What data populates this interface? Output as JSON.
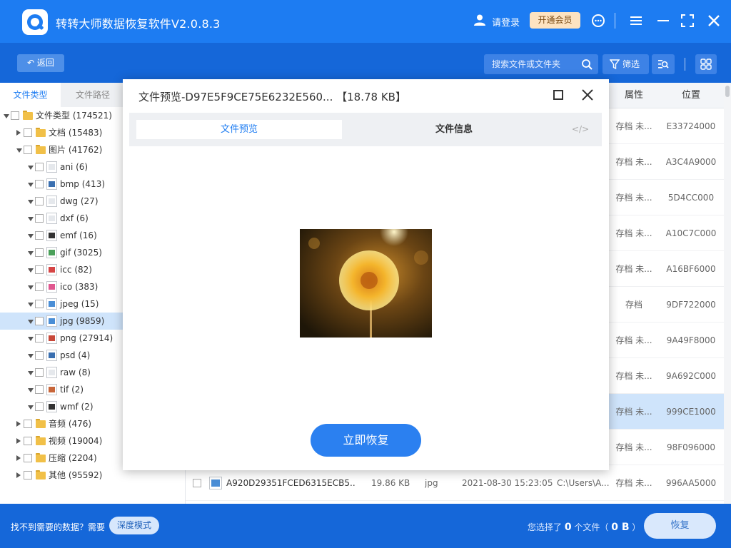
{
  "app": {
    "title": "转转大师数据恢复软件V2.0.8.3",
    "login_label": "请登录",
    "vip_label": "开通会员",
    "brand_color": "#1d7cf2"
  },
  "toolbar": {
    "back_label": "返回",
    "search_placeholder": "搜索文件或文件夹",
    "filter_label": "筛选"
  },
  "sidebar": {
    "tabs": [
      "文件类型",
      "文件路径"
    ],
    "tree": [
      {
        "label": "文件类型",
        "count": "(174521)",
        "type": "folder",
        "expanded": true
      },
      {
        "label": "文档",
        "count": "(15483)",
        "type": "folder",
        "expanded": false
      },
      {
        "label": "图片",
        "count": "(41762)",
        "type": "folder",
        "expanded": true
      },
      {
        "label": "ani",
        "count": "(6)",
        "type": "file",
        "icon": "ani-file-icon"
      },
      {
        "label": "bmp",
        "count": "(413)",
        "type": "file",
        "icon": "bmp-file-icon"
      },
      {
        "label": "dwg",
        "count": "(27)",
        "type": "file",
        "icon": "dwg-file-icon"
      },
      {
        "label": "dxf",
        "count": "(6)",
        "type": "file",
        "icon": "dxf-file-icon"
      },
      {
        "label": "emf",
        "count": "(16)",
        "type": "file",
        "icon": "emf-file-icon"
      },
      {
        "label": "gif",
        "count": "(3025)",
        "type": "file",
        "icon": "gif-file-icon"
      },
      {
        "label": "icc",
        "count": "(82)",
        "type": "file",
        "icon": "icc-file-icon"
      },
      {
        "label": "ico",
        "count": "(383)",
        "type": "file",
        "icon": "ico-file-icon"
      },
      {
        "label": "jpeg",
        "count": "(15)",
        "type": "file",
        "icon": "jpeg-file-icon"
      },
      {
        "label": "jpg",
        "count": "(9859)",
        "type": "file",
        "icon": "jpg-file-icon",
        "selected": true
      },
      {
        "label": "png",
        "count": "(27914)",
        "type": "file",
        "icon": "png-file-icon"
      },
      {
        "label": "psd",
        "count": "(4)",
        "type": "file",
        "icon": "psd-file-icon"
      },
      {
        "label": "raw",
        "count": "(8)",
        "type": "file",
        "icon": "raw-file-icon"
      },
      {
        "label": "tif",
        "count": "(2)",
        "type": "file",
        "icon": "tif-file-icon"
      },
      {
        "label": "wmf",
        "count": "(2)",
        "type": "file",
        "icon": "wmf-file-icon"
      },
      {
        "label": "音频",
        "count": "(476)",
        "type": "folder",
        "expanded": false
      },
      {
        "label": "视频",
        "count": "(19004)",
        "type": "folder",
        "expanded": false
      },
      {
        "label": "压缩",
        "count": "(2204)",
        "type": "folder",
        "expanded": false
      },
      {
        "label": "其他",
        "count": "(95592)",
        "type": "folder",
        "expanded": false
      }
    ]
  },
  "main": {
    "columns": {
      "attr": "属性",
      "location": "位置"
    },
    "rows": [
      {
        "attr": "存档 未...",
        "location": "E33724000"
      },
      {
        "attr": "存档 未...",
        "location": "A3C4A9000"
      },
      {
        "attr": "存档 未...",
        "location": "5D4CC000"
      },
      {
        "attr": "存档 未...",
        "location": "A10C7C000"
      },
      {
        "attr": "存档 未...",
        "location": "A16BF6000"
      },
      {
        "attr": "存档",
        "location": "9DF722000"
      },
      {
        "attr": "存档 未...",
        "location": "9A49F8000"
      },
      {
        "attr": "存档 未...",
        "location": "9A692C000"
      },
      {
        "attr": "存档 未...",
        "location": "999CE1000",
        "selected": true
      },
      {
        "attr": "存档 未...",
        "location": "98F096000"
      },
      {
        "name": "A920D29351FCED6315ECB5...",
        "size": "19.86 KB",
        "type": "jpg",
        "date": "2021-08-30 15:23:05",
        "path": "C:\\Users\\A...",
        "attr": "存档 未...",
        "location": "996AA5000"
      }
    ]
  },
  "bottom": {
    "hint": "找不到需要的数据？需要",
    "deep_mode_label": "深度模式",
    "selected_prefix": "您选择了",
    "selected_count": "0",
    "selected_mid": "个文件（",
    "selected_size": "0 B",
    "selected_suffix": "）",
    "recover_label": "恢复"
  },
  "dialog": {
    "title": "文件预览-D97E5F9CE75E6232E560... 【18.78 KB】",
    "tabs": {
      "preview": "文件预览",
      "info": "文件信息",
      "code": "</>"
    },
    "recover_label": "立即恢复"
  }
}
